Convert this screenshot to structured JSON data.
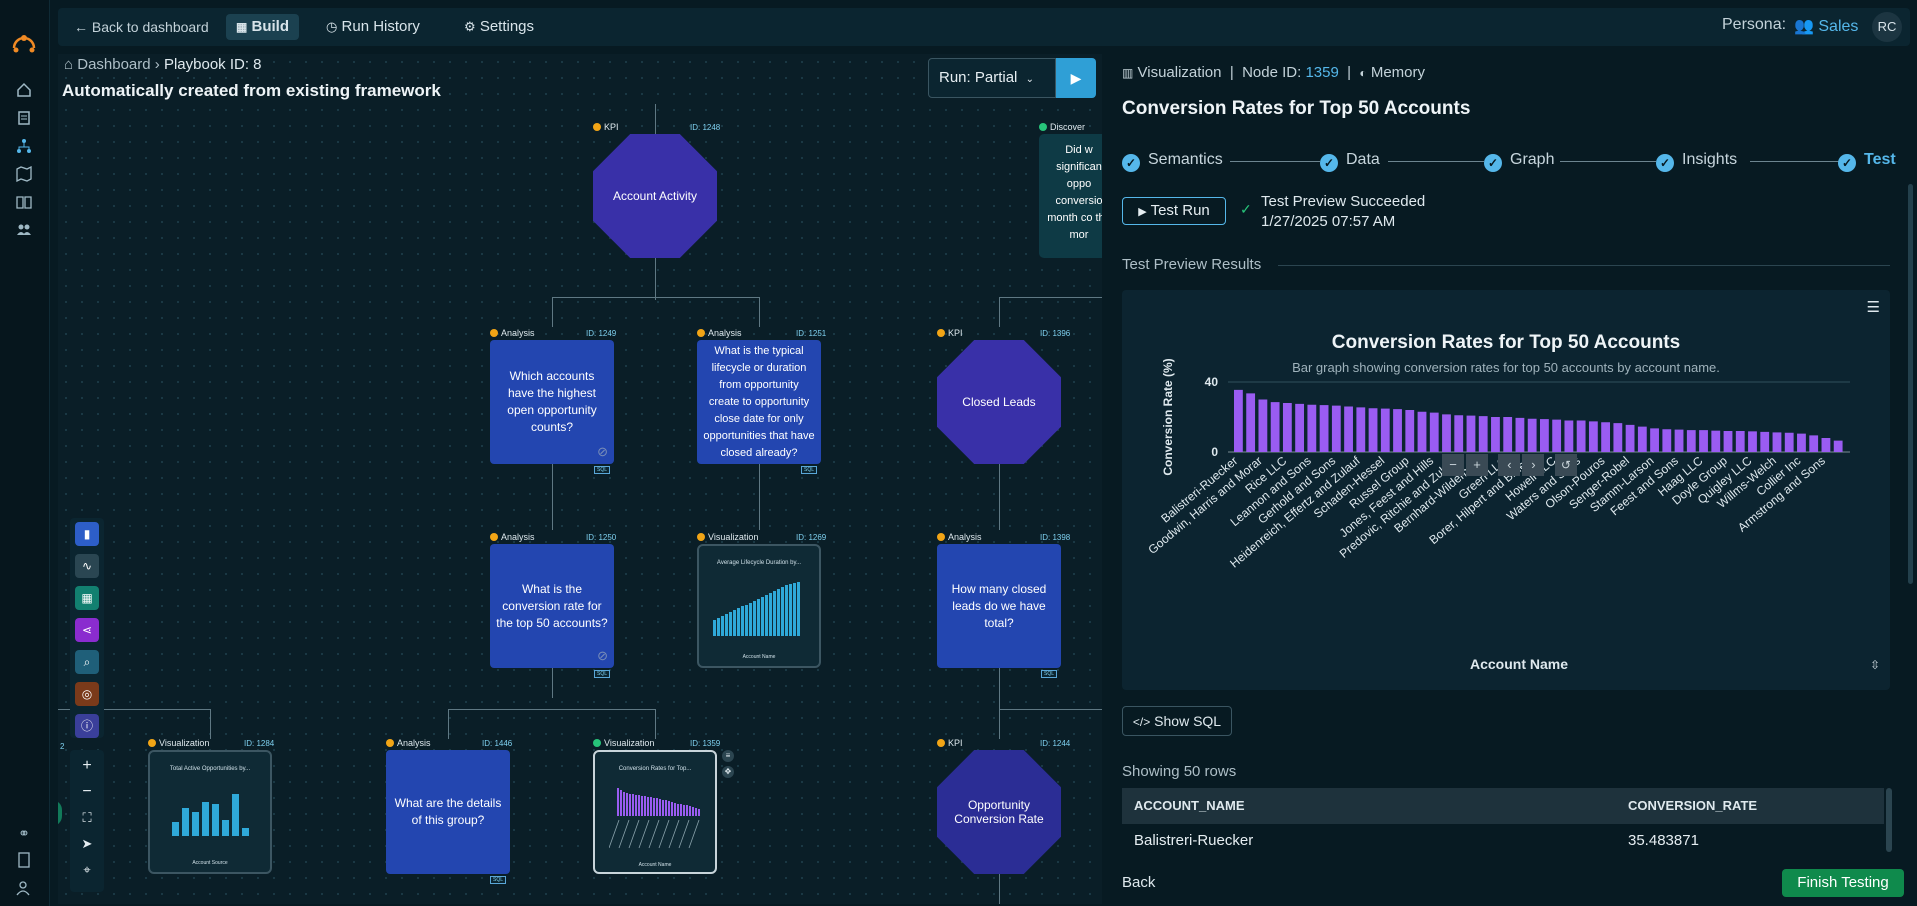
{
  "topbar": {
    "back_label": "Back to dashboard",
    "build_label": "Build",
    "run_history_label": "Run History",
    "settings_label": "Settings",
    "persona_label": "Persona:",
    "persona_value": "Sales",
    "avatar_initials": "RC"
  },
  "breadcrumb": {
    "home": "Dashboard",
    "current": "Playbook ID: 8"
  },
  "page_title": "Automatically created from existing framework",
  "run": {
    "label": "Run:",
    "mode": "Partial"
  },
  "nodes": {
    "n1248": {
      "type": "KPI",
      "id": "ID: 1248",
      "text": "Account Activity"
    },
    "n1249": {
      "type": "Analysis",
      "id": "ID: 1249",
      "text": "Which accounts have the highest open opportunity counts?",
      "sql": "SQL"
    },
    "n1251": {
      "type": "Analysis",
      "id": "ID: 1251",
      "text": "What is the typical lifecycle or duration from opportunity create to opportunity close date for only opportunities that have closed already?",
      "sql": "SQL"
    },
    "n1396": {
      "type": "KPI",
      "id": "ID: 1396",
      "text": "Closed Leads"
    },
    "n_discover": {
      "type": "Discover",
      "text": "Did w significan oppo conversio month co the mor"
    },
    "n1250": {
      "type": "Analysis",
      "id": "ID: 1250",
      "text": "What is the conversion rate for the top 50 accounts?",
      "sql": "SQL"
    },
    "n1269": {
      "type": "Visualization",
      "id": "ID: 1269",
      "title": "Average Lifecycle Duration by...",
      "xlabel": "Account Name"
    },
    "n1398": {
      "type": "Analysis",
      "id": "ID: 1398",
      "text": "How many closed leads do we have total?",
      "sql": "SQL"
    },
    "n1284": {
      "type": "Visualization",
      "id": "ID: 1284",
      "title": "Total Active Opportunities by...",
      "xlabel": "Account Source"
    },
    "n1446": {
      "type": "Analysis",
      "id": "ID: 1446",
      "text": "What are the details of this group?",
      "sql": "SQL"
    },
    "n1359": {
      "type": "Visualization",
      "id": "ID: 1359",
      "title": "Conversion Rates for Top...",
      "xlabel": "Account Name"
    },
    "n1244": {
      "type": "KPI",
      "id": "ID: 1244",
      "text": "Opportunity Conversion Rate"
    },
    "partial_id": "2"
  },
  "panel": {
    "header": {
      "type": "Visualization",
      "sep": "|",
      "node_label": "Node ID:",
      "node_id": "1359",
      "memory": "Memory"
    },
    "title": "Conversion Rates for Top 50 Accounts",
    "steps": [
      "Semantics",
      "Data",
      "Graph",
      "Insights",
      "Test"
    ],
    "test_run_label": "Test Run",
    "status_title": "Test Preview Succeeded",
    "status_time": "1/27/2025 07:57 AM",
    "results_label": "Test Preview Results",
    "show_sql_label": "Show SQL",
    "rows_label": "Showing 50 rows",
    "table": {
      "columns": [
        "ACCOUNT_NAME",
        "CONVERSION_RATE"
      ],
      "rows": [
        [
          "Balistreri-Ruecker",
          "35.483871"
        ]
      ]
    },
    "back_label": "Back",
    "finish_label": "Finish Testing"
  },
  "colors": {
    "accent": "#55b7ea",
    "bar": "#9a5cf2",
    "finish": "#0f8a4c",
    "kpi": "#3930a8",
    "analysis": "#2346b0"
  },
  "chart_data": {
    "type": "bar",
    "title": "Conversion Rates for Top 50 Accounts",
    "subtitle": "Bar graph showing conversion rates for top 50 accounts by account name.",
    "xlabel": "Account Name",
    "ylabel": "Conversion Rate (%)",
    "ylim": [
      0,
      40
    ],
    "yticks": [
      0,
      40
    ],
    "grid": true,
    "categories": [
      "Balistreri-Ruecker",
      "",
      "Goodwin, Harris and Morar",
      "",
      "Rice LLC",
      "",
      "Leannon and Sons",
      "",
      "Gerhold and Sons",
      "",
      "Heidenreich, Effertz and Zulauf",
      "",
      "Schaden-Hessel",
      "",
      "Russel Group",
      "",
      "Jones, Feest and Hills",
      "",
      "Predovic, Ritchie and Zulauf",
      "",
      "Bernhard-Wilderman",
      "",
      "Green LLC",
      "",
      "Borer, Hilpert and Bruen",
      "",
      "Howell LLC",
      "",
      "Waters and Sons",
      "",
      "Olson-Pouros",
      "",
      "Senger-Robel",
      "",
      "Stamm-Larson",
      "",
      "Feest and Sons",
      "",
      "Haag LLC",
      "",
      "Doyle Group",
      "",
      "Quigley LLC",
      "",
      "Willms-Welch",
      "",
      "Collier Inc",
      "",
      "Armstrong and Sons",
      ""
    ],
    "values": [
      35.5,
      33.5,
      30,
      28.5,
      28,
      27.5,
      27,
      26.8,
      26.5,
      26,
      25.5,
      25,
      24.8,
      24.5,
      24,
      23,
      22.5,
      21.5,
      21,
      20.8,
      20.5,
      20,
      20,
      19.5,
      19,
      18.8,
      18.5,
      18,
      18,
      17.5,
      17,
      16.5,
      15.5,
      14.5,
      13.5,
      13,
      12.8,
      12.5,
      12.5,
      12.2,
      12,
      12,
      11.8,
      11.5,
      11.2,
      11,
      10.5,
      9.5,
      8,
      6.5
    ]
  }
}
